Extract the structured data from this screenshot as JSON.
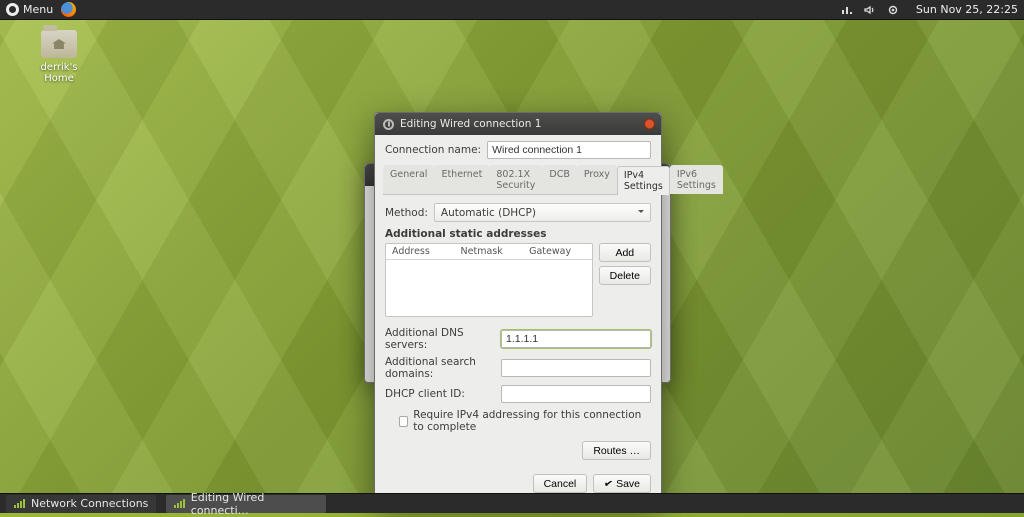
{
  "panel": {
    "menu_label": "Menu",
    "clock": "Sun Nov 25, 22:25"
  },
  "desktop": {
    "home_label": "derrik's Home"
  },
  "taskbar": {
    "item1": "Network Connections",
    "item2": "Editing Wired connecti…"
  },
  "dialog": {
    "title": "Editing Wired connection 1",
    "conn_name_label": "Connection name:",
    "conn_name_value": "Wired connection 1",
    "tabs": {
      "general": "General",
      "ethernet": "Ethernet",
      "sec": "802.1X Security",
      "dcb": "DCB",
      "proxy": "Proxy",
      "ipv4": "IPv4 Settings",
      "ipv6": "IPv6 Settings"
    },
    "method_label": "Method:",
    "method_value": "Automatic (DHCP)",
    "addr_section": "Additional static addresses",
    "col_address": "Address",
    "col_netmask": "Netmask",
    "col_gateway": "Gateway",
    "add_btn": "Add",
    "delete_btn": "Delete",
    "dns_label": "Additional DNS servers:",
    "dns_value": "1.1.1.1",
    "search_label": "Additional search domains:",
    "search_value": "",
    "dhcp_label": "DHCP client ID:",
    "dhcp_value": "",
    "require_label": "Require IPv4 addressing for this connection to complete",
    "routes_btn": "Routes …",
    "cancel_btn": "Cancel",
    "save_btn": "Save"
  }
}
